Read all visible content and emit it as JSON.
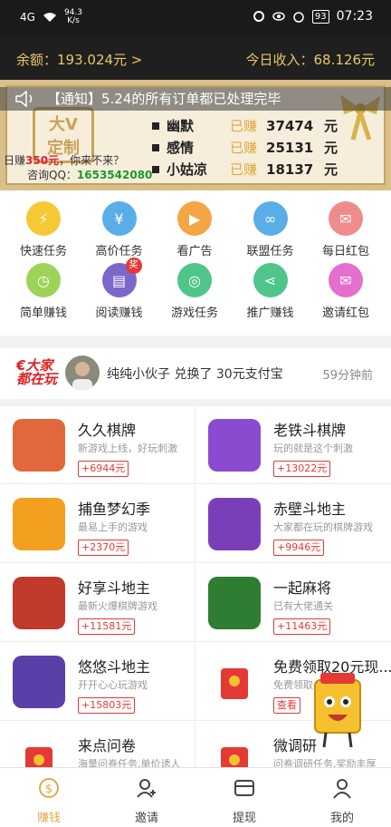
{
  "status": {
    "signal": "4G",
    "speed_top": "94.3",
    "speed_bottom": "K/s",
    "battery": "93",
    "time": "07:23"
  },
  "header": {
    "balance": "余额：193.024元 >",
    "income": "今日收入：68.126元"
  },
  "banner": {
    "notice": "【通知】5.24的所有订单都已处理完毕",
    "logo_line1": "大V",
    "logo_line2": "定制",
    "promo_line1_pre": "日赚",
    "promo_line1_amt": "350元",
    "promo_line1_post": "，你来不来？",
    "promo_line2_pre": "咨询QQ：",
    "promo_line2_qq": "1653542080",
    "earners": [
      {
        "name": "幽默",
        "earned": "已赚",
        "amount": "37474",
        "unit": "元"
      },
      {
        "name": "感情",
        "earned": "已赚",
        "amount": "25131",
        "unit": "元"
      },
      {
        "name": "小姑凉",
        "earned": "已赚",
        "amount": "18137",
        "unit": "元"
      }
    ]
  },
  "grid": [
    {
      "label": "快速任务",
      "icon": "lightning-icon",
      "color": "#f7c836"
    },
    {
      "label": "高价任务",
      "icon": "money-jar-icon",
      "color": "#5aaee8"
    },
    {
      "label": "看广告",
      "icon": "tv-icon",
      "color": "#f2a646"
    },
    {
      "label": "联盟任务",
      "icon": "link-nodes-icon",
      "color": "#5aaee8"
    },
    {
      "label": "每日红包",
      "icon": "red-packet-icon",
      "color": "#f08b8b"
    },
    {
      "label": "简单赚钱",
      "icon": "clock-icon",
      "color": "#9ed35a"
    },
    {
      "label": "阅读赚钱",
      "icon": "book-icon",
      "color": "#7b68c8",
      "badge": "奖"
    },
    {
      "label": "游戏任务",
      "icon": "gamepad-icon",
      "color": "#4fc58a"
    },
    {
      "label": "推广赚钱",
      "icon": "share-icon",
      "color": "#4fc58a"
    },
    {
      "label": "邀请红包",
      "icon": "envelope-icon",
      "color": "#e46fcf"
    }
  ],
  "ticker": {
    "logo_line1": "€大家",
    "logo_line2": "都在玩",
    "text": "纯纯小伙子 兑换了 30元支付宝",
    "time": "59分钟前"
  },
  "games": [
    {
      "title": "久久棋牌",
      "desc": "新游戏上线，好玩刺激",
      "reward": "+6944元",
      "color": "#e0683a"
    },
    {
      "title": "老铁斗棋牌",
      "desc": "玩的就是这个刺激",
      "reward": "+13022元",
      "color": "#8a4bd0"
    },
    {
      "title": "捕鱼梦幻季",
      "desc": "最易上手的游戏",
      "reward": "+2370元",
      "color": "#f3a020"
    },
    {
      "title": "赤壁斗地主",
      "desc": "大家都在玩的棋牌游戏",
      "reward": "+9946元",
      "color": "#7a3fb8"
    },
    {
      "title": "好享斗地主",
      "desc": "最新火爆棋牌游戏",
      "reward": "+11581元",
      "color": "#c0392b"
    },
    {
      "title": "一起麻将",
      "desc": "已有大佬通关",
      "reward": "+11463元",
      "color": "#2e7d32"
    },
    {
      "title": "悠悠斗地主",
      "desc": "开开心心玩游戏",
      "reward": "+15803元",
      "color": "#5b3fa8"
    },
    {
      "title": "免费领取20元现...",
      "desc": "免费领取",
      "reward": "查看",
      "color": "#ffffff"
    },
    {
      "title": "来点问卷",
      "desc": "海量问卷任务,单价诱人",
      "reward": "",
      "color": "#ffffff"
    },
    {
      "title": "微调研",
      "desc": "问卷调研任务,奖励丰厚",
      "reward": "",
      "color": "#ffffff"
    }
  ],
  "tabs": [
    {
      "label": "赚钱",
      "icon": "coin-icon"
    },
    {
      "label": "邀请",
      "icon": "add-user-icon"
    },
    {
      "label": "提现",
      "icon": "wallet-icon"
    },
    {
      "label": "我的",
      "icon": "user-icon"
    }
  ]
}
